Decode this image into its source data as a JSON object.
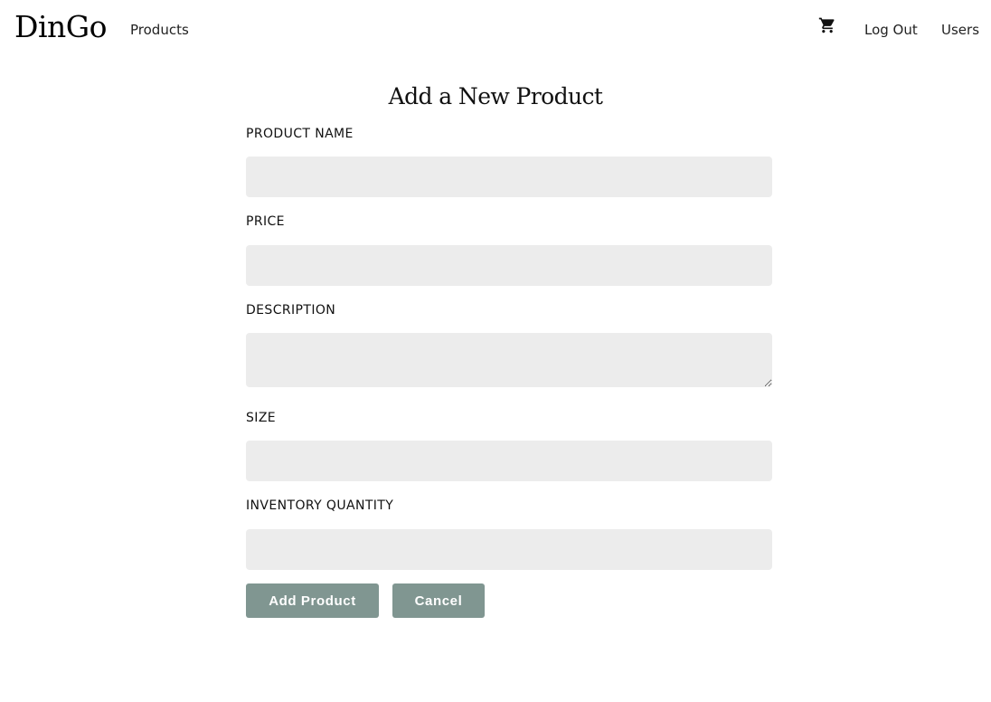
{
  "nav": {
    "brand": "DinGo",
    "products_link": "Products",
    "cart_icon": "shopping-cart-icon",
    "logout_link": "Log Out",
    "users_link": "Users"
  },
  "form": {
    "title": "Add a New Product",
    "fields": [
      {
        "label": "PRODUCT NAME",
        "value": "",
        "placeholder": ""
      },
      {
        "label": "PRICE",
        "value": "",
        "placeholder": ""
      },
      {
        "label": "DESCRIPTION",
        "value": "",
        "placeholder": ""
      },
      {
        "label": "SIZE",
        "value": "",
        "placeholder": ""
      },
      {
        "label": "INVENTORY QUANTITY",
        "value": "",
        "placeholder": ""
      }
    ],
    "submit_label": "Add Product",
    "cancel_label": "Cancel"
  },
  "colors": {
    "button_bg": "#809691",
    "input_bg": "#ececec"
  }
}
